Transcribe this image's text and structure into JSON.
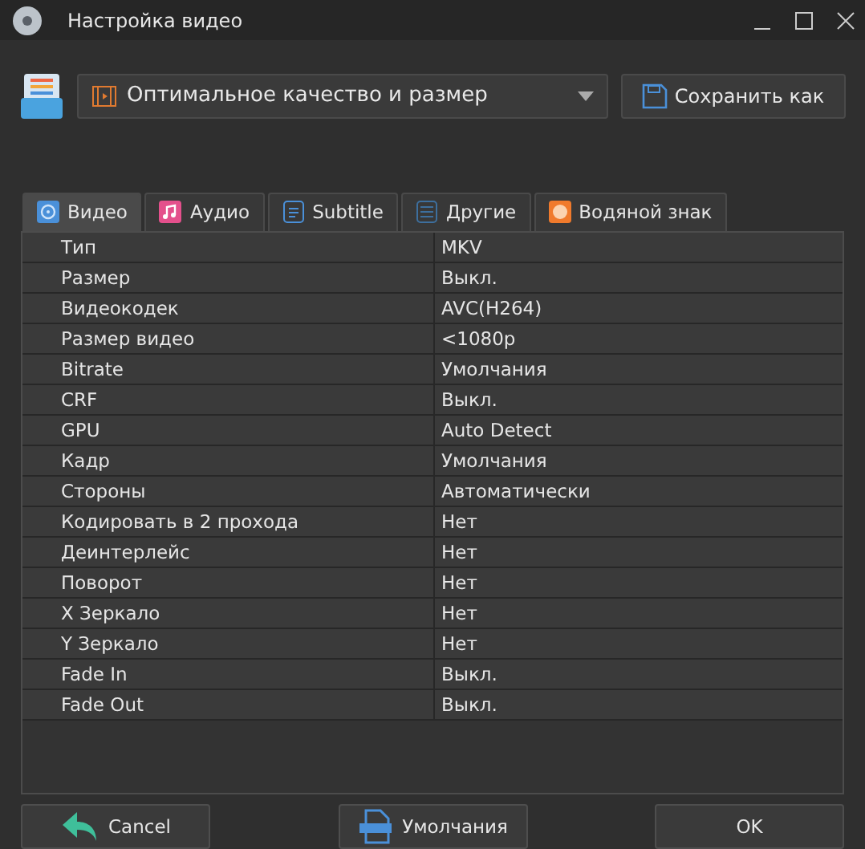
{
  "window": {
    "title": "Настройка видео"
  },
  "preset": {
    "value": "Оптимальное качество и размер"
  },
  "save_button": "Сохранить как",
  "tabs": [
    {
      "label": "Видео",
      "kind": "video",
      "selected": true
    },
    {
      "label": "Аудио",
      "kind": "audio",
      "selected": false
    },
    {
      "label": "Subtitle",
      "kind": "subtitle",
      "selected": false
    },
    {
      "label": "Другие",
      "kind": "other",
      "selected": false
    },
    {
      "label": "Водяной знак",
      "kind": "watermark",
      "selected": false
    }
  ],
  "properties": [
    {
      "name": "Тип",
      "value": "MKV"
    },
    {
      "name": "Размер",
      "value": "Выкл."
    },
    {
      "name": "Видеокодек",
      "value": "AVC(H264)"
    },
    {
      "name": "Размер видео",
      "value": "<1080p"
    },
    {
      "name": "Bitrate",
      "value": "Умолчания"
    },
    {
      "name": "CRF",
      "value": "Выкл."
    },
    {
      "name": "GPU",
      "value": "Auto Detect"
    },
    {
      "name": "Кадр",
      "value": "Умолчания"
    },
    {
      "name": "Стороны",
      "value": "Автоматически"
    },
    {
      "name": "Кодировать в 2 прохода",
      "value": "Нет"
    },
    {
      "name": "Деинтерлейс",
      "value": "Нет"
    },
    {
      "name": "Поворот",
      "value": "Нет"
    },
    {
      "name": "X Зеркало",
      "value": "Нет"
    },
    {
      "name": "Y Зеркало",
      "value": "Нет"
    },
    {
      "name": "Fade In",
      "value": "Выкл."
    },
    {
      "name": "Fade Out",
      "value": "Выкл."
    }
  ],
  "buttons": [
    {
      "label": "Cancel",
      "kind": "cancel"
    },
    {
      "label": "Умолчания",
      "kind": "default"
    },
    {
      "label": "OK",
      "kind": "ok"
    }
  ]
}
